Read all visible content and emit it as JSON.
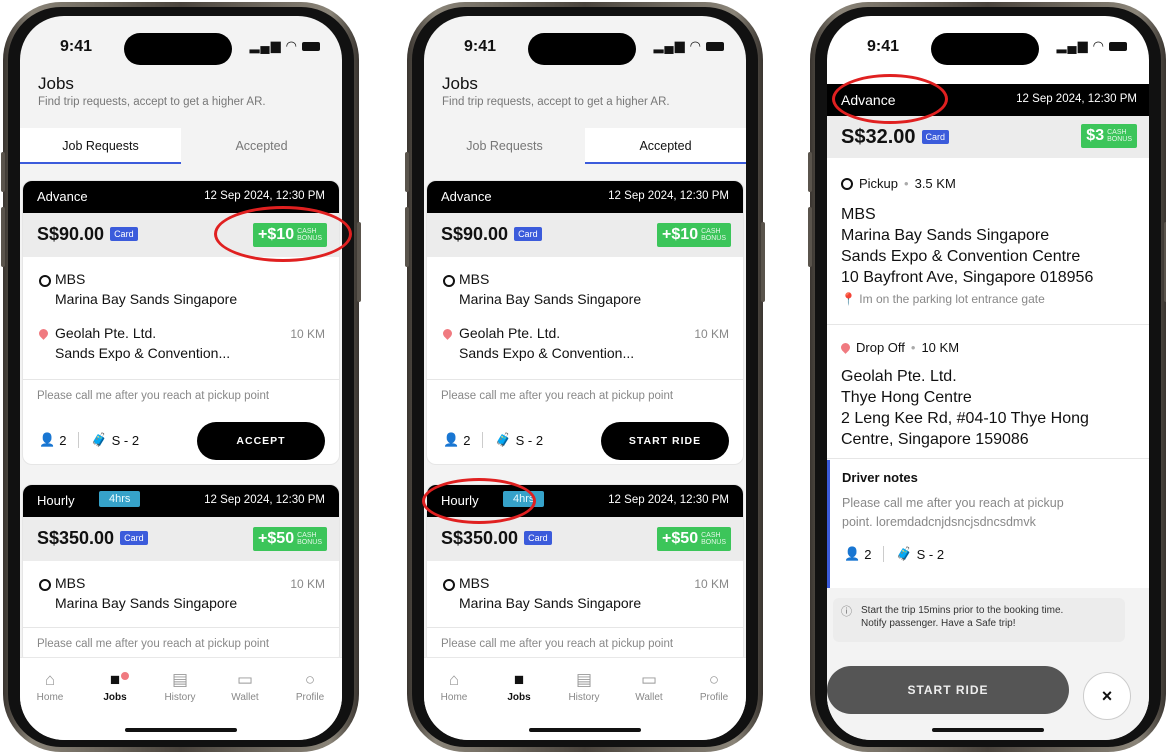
{
  "status": {
    "time": "9:41"
  },
  "header": {
    "title": "Jobs",
    "subtitle": "Find trip requests, accept to get a higher AR."
  },
  "tabs": [
    "Job Requests",
    "Accepted"
  ],
  "nav": [
    "Home",
    "Jobs",
    "History",
    "Wallet",
    "Profile"
  ],
  "card1": {
    "type": "Advance",
    "date": "12 Sep 2024, 12:30 PM",
    "price": "S$90.00",
    "card_tag": "Card",
    "bonus_amount": "+$10",
    "bonus_l1": "CASH",
    "bonus_l2": "BONUS",
    "pickup_name": "MBS",
    "pickup_addr": "Marina Bay Sands Singapore",
    "drop_name": "Geolah Pte. Ltd.",
    "drop_addr": "Sands Expo & Convention...",
    "distance": "10 KM",
    "note": "Please call me after you reach at pickup point",
    "pax": "2",
    "luggage": "S - 2"
  },
  "card2": {
    "type": "Hourly",
    "hours": "4hrs",
    "date": "12 Sep 2024, 12:30 PM",
    "price": "S$350.00",
    "card_tag": "Card",
    "bonus_amount": "+$50",
    "bonus_l1": "CASH",
    "bonus_l2": "BONUS",
    "pickup_name": "MBS",
    "pickup_addr": "Marina Bay Sands Singapore",
    "distance": "10 KM",
    "note": "Please call me after you reach at pickup point"
  },
  "phone1": {
    "action": "ACCEPT"
  },
  "phone2": {
    "action": "START RIDE"
  },
  "detail": {
    "type": "Advance",
    "date": "12 Sep 2024, 12:30 PM",
    "price": "S$32.00",
    "card_tag": "Card",
    "bonus_amount": "$3",
    "bonus_l1": "CASH",
    "bonus_l2": "BONUS",
    "pickup_label": "Pickup",
    "pickup_dist": "3.5 KM",
    "pickup_lines": [
      "MBS",
      "Marina Bay Sands Singapore",
      "Sands Expo & Convention Centre",
      "10 Bayfront Ave, Singapore 018956"
    ],
    "pickup_hint": "Im on the parking lot entrance gate",
    "drop_label": "Drop Off",
    "drop_dist": "10 KM",
    "drop_lines": [
      "Geolah Pte. Ltd.",
      "Thye Hong Centre",
      "2 Leng Kee Rd, #04-10 Thye Hong",
      "Centre, Singapore 159086"
    ],
    "notes_title": "Driver notes",
    "notes_l1": "Please call me after you reach at pickup",
    "notes_l2": "point. loremdadcnjdsncjsdncsdmvk",
    "pax": "2",
    "luggage": "S - 2",
    "info_l1": "Start the trip 15mins prior to the booking time.",
    "info_l2": "Notify passenger. Have a Safe trip!",
    "start_label": "START RIDE",
    "close": "×"
  }
}
